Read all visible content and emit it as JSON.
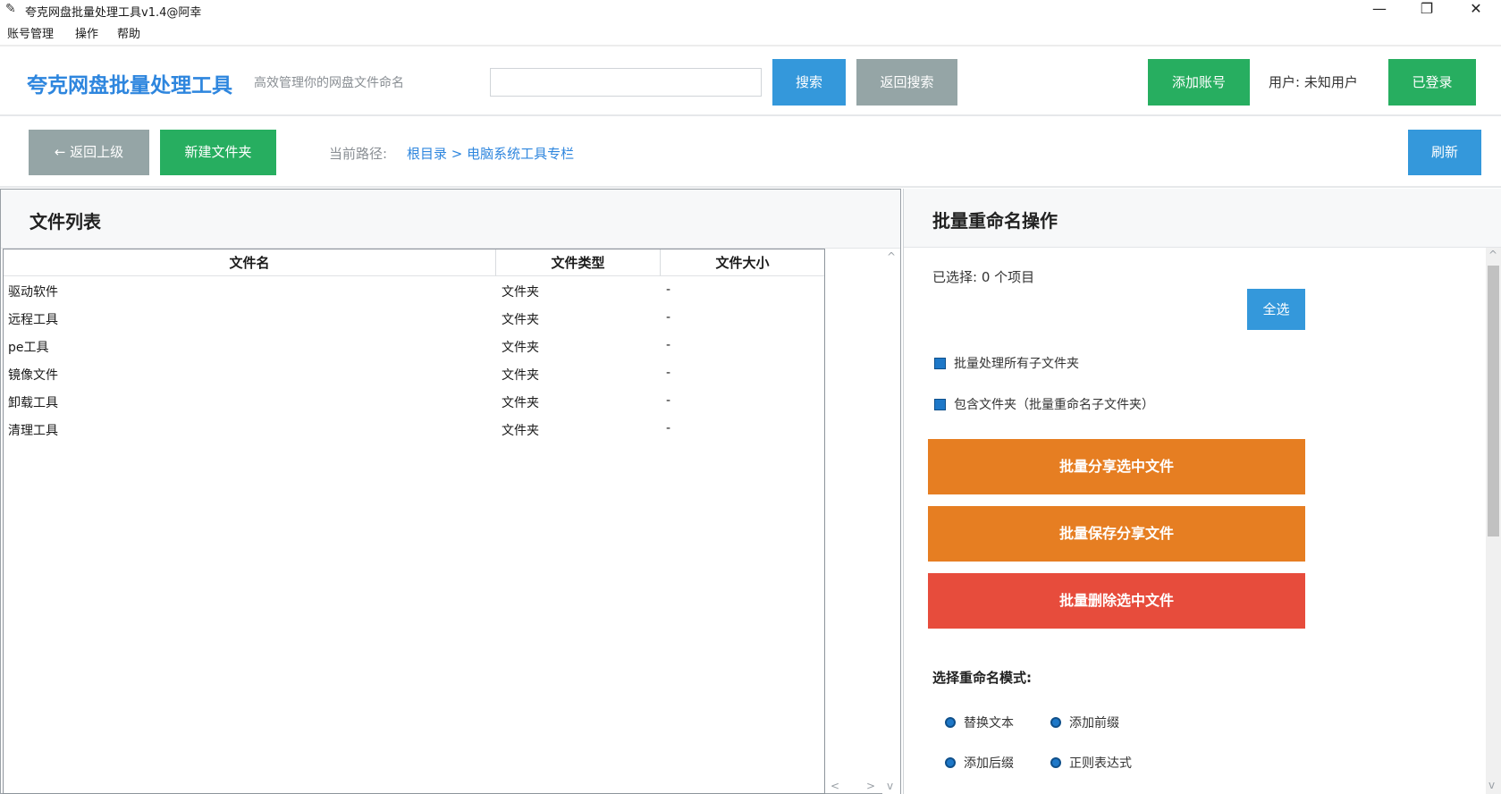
{
  "window": {
    "title": "夸克网盘批量处理工具v1.4@阿幸",
    "controls": {
      "minimize": "—",
      "restore": "❐",
      "close": "✕"
    }
  },
  "menu": [
    "账号管理",
    "操作",
    "帮助"
  ],
  "header": {
    "brand": "夸克网盘批量处理工具",
    "tagline": "高效管理你的网盘文件命名",
    "search_value": "",
    "search_button": "搜索",
    "back_search_button": "返回搜索",
    "add_account_button": "添加账号",
    "user_label": "用户: 未知用户",
    "login_button": "已登录"
  },
  "toolbar": {
    "back_button": "← 返回上级",
    "new_folder_button": "新建文件夹",
    "path_label": "当前路径:",
    "path_value": "根目录 > 电脑系统工具专栏",
    "refresh_button": "刷新"
  },
  "file_list": {
    "title": "文件列表",
    "columns": [
      "文件名",
      "文件类型",
      "文件大小"
    ],
    "rows": [
      {
        "name": "驱动软件",
        "type": "文件夹",
        "size": "-"
      },
      {
        "name": "远程工具",
        "type": "文件夹",
        "size": "-"
      },
      {
        "name": "pe工具",
        "type": "文件夹",
        "size": "-"
      },
      {
        "name": "镜像文件",
        "type": "文件夹",
        "size": "-"
      },
      {
        "name": "卸载工具",
        "type": "文件夹",
        "size": "-"
      },
      {
        "name": "清理工具",
        "type": "文件夹",
        "size": "-"
      }
    ]
  },
  "batch_panel": {
    "title": "批量重命名操作",
    "selected_text": "已选择: 0 个项目",
    "select_all_button": "全选",
    "checkbox_subfolders": "批量处理所有子文件夹",
    "checkbox_include_folders": "包含文件夹（批量重命名子文件夹）",
    "share_button": "批量分享选中文件",
    "save_share_button": "批量保存分享文件",
    "delete_button": "批量删除选中文件",
    "mode_label": "选择重命名模式:",
    "modes": [
      "替换文本",
      "添加前缀",
      "添加后缀",
      "正则表达式"
    ]
  },
  "colors": {
    "primary_blue": "#3498db",
    "green": "#27ae60",
    "gray": "#95a5a6",
    "orange": "#e67e22",
    "red": "#e74c3c",
    "brand_blue": "#2e86de"
  }
}
